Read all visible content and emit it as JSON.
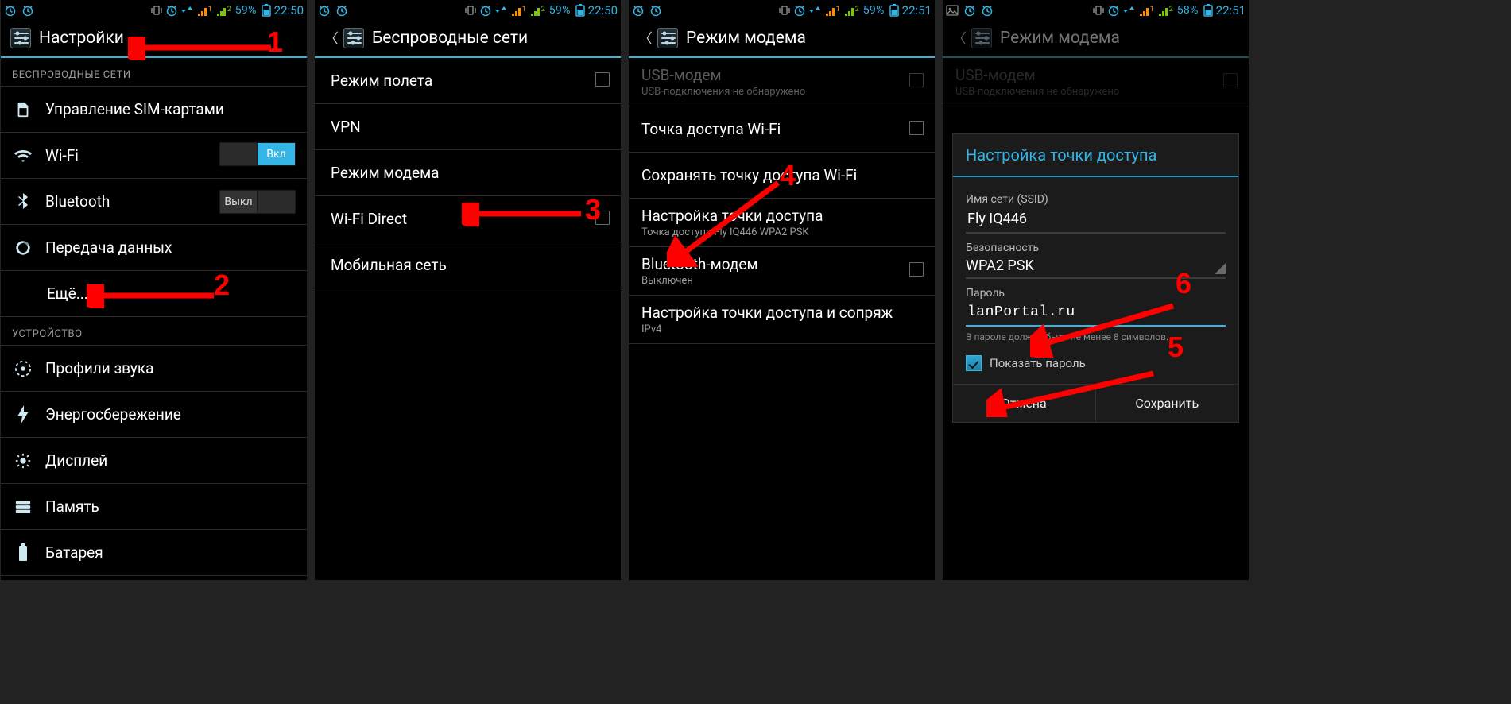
{
  "statusbar": {
    "battery": "59%",
    "battery4": "58%",
    "time12": "22:50",
    "time3": "22:51",
    "time4": "22:51"
  },
  "s1": {
    "title": "Настройки",
    "section_wireless": "Беспроводные сети",
    "section_device": "Устройство",
    "sim": "Управление SIM-картами",
    "wifi": "Wi-Fi",
    "wifi_toggle": "Вкл",
    "bt": "Bluetooth",
    "bt_toggle": "Выкл",
    "data": "Передача данных",
    "more": "Ещё...",
    "audio": "Профили звука",
    "power": "Энергосбережение",
    "display": "Дисплей",
    "memory": "Память",
    "battery": "Батарея"
  },
  "s2": {
    "title": "Беспроводные сети",
    "airplane": "Режим полета",
    "vpn": "VPN",
    "tether": "Режим модема",
    "wifidirect": "Wi-Fi Direct",
    "mobile": "Мобильная сеть"
  },
  "s3": {
    "title": "Режим модема",
    "usb": "USB-модем",
    "usb_sub": "USB-подключения не обнаружено",
    "ap": "Точка доступа Wi-Fi",
    "apkeep": "Сохранять точку доступа Wi-Fi",
    "apcfg": "Настройка точки доступа",
    "apcfg_sub": "Точка доступа Fly IQ446 WPA2 PSK",
    "btt": "Bluetooth-модем",
    "btt_sub": "Выключен",
    "pair": "Настройка точки доступа и сопряж",
    "pair_sub": "IPv4"
  },
  "s4": {
    "title": "Режим модема",
    "usb": "USB-модем",
    "usb_sub": "USB-подключения не обнаружено",
    "dlg_title": "Настройка точки доступа",
    "ssid_label": "Имя сети (SSID)",
    "ssid": "Fly IQ446",
    "sec_label": "Безопасность",
    "sec": "WPA2 PSK",
    "pwd_label": "Пароль",
    "pwd": "lanPortal.ru",
    "pwd_hint": "В пароле должно быть не менее 8 символов.",
    "showpwd": "Показать пароль",
    "cancel": "Отмена",
    "save": "Сохранить"
  },
  "steps": {
    "n1": "1",
    "n2": "2",
    "n3": "3",
    "n4": "4",
    "n5": "5",
    "n6": "6"
  }
}
